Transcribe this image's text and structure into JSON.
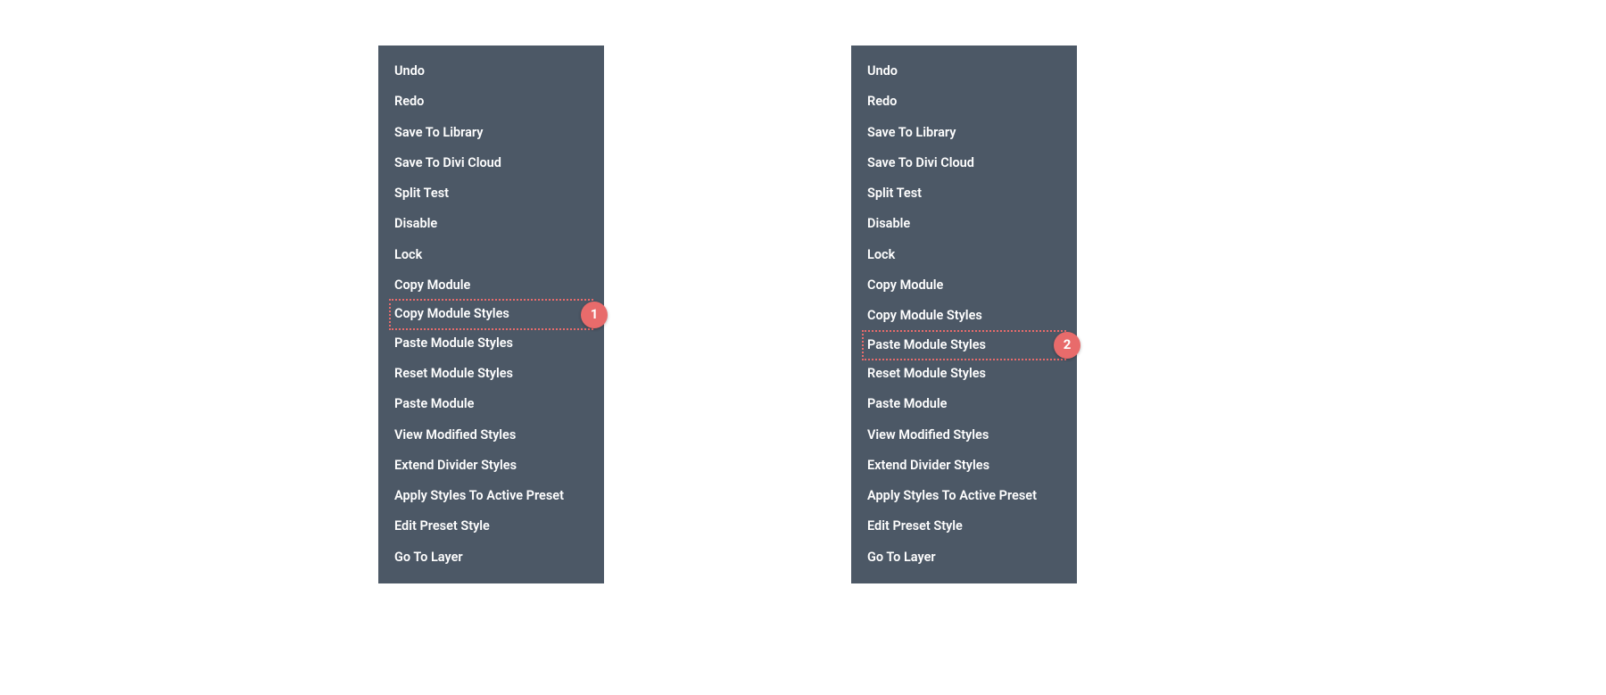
{
  "menus": [
    {
      "highlightedIndex": 8,
      "badgeNumber": "1",
      "items": [
        "Undo",
        "Redo",
        "Save To Library",
        "Save To Divi Cloud",
        "Split Test",
        "Disable",
        "Lock",
        "Copy Module",
        "Copy Module Styles",
        "Paste Module Styles",
        "Reset Module Styles",
        "Paste Module",
        "View Modified Styles",
        "Extend Divider Styles",
        "Apply Styles To Active Preset",
        "Edit Preset Style",
        "Go To Layer"
      ]
    },
    {
      "highlightedIndex": 9,
      "badgeNumber": "2",
      "items": [
        "Undo",
        "Redo",
        "Save To Library",
        "Save To Divi Cloud",
        "Split Test",
        "Disable",
        "Lock",
        "Copy Module",
        "Copy Module Styles",
        "Paste Module Styles",
        "Reset Module Styles",
        "Paste Module",
        "View Modified Styles",
        "Extend Divider Styles",
        "Apply Styles To Active Preset",
        "Edit Preset Style",
        "Go To Layer"
      ]
    }
  ]
}
